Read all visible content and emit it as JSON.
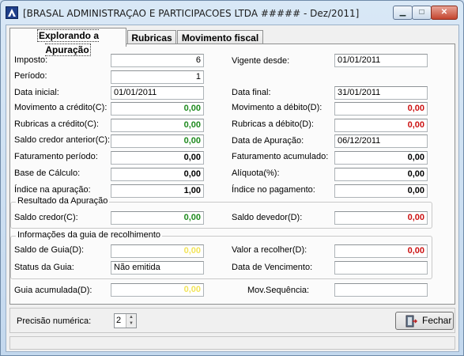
{
  "window": {
    "title": "[BRASAL ADMINISTRAÇAO E PARTICIPACOES LTDA ##### - Dez/2011]",
    "minimize": "▁",
    "maximize": "□",
    "close": "✕"
  },
  "tabs": [
    {
      "label": "Explorando a Apuração"
    },
    {
      "label": "Rubricas"
    },
    {
      "label": "Movimento fiscal"
    }
  ],
  "fields": {
    "imposto": {
      "label": "Imposto:",
      "value": "6"
    },
    "periodo": {
      "label": "Período:",
      "value": "1"
    },
    "data_inicial": {
      "label": "Data inicial:",
      "value": "01/01/2011"
    },
    "mov_credito": {
      "label": "Movimento a crédito(C):",
      "value": "0,00"
    },
    "rub_credito": {
      "label": "Rubricas a crédito(C):",
      "value": "0,00"
    },
    "saldo_credor_anterior": {
      "label": "Saldo credor anterior(C):",
      "value": "0,00"
    },
    "faturamento_periodo": {
      "label": "Faturamento período:",
      "value": "0,00"
    },
    "base_calculo": {
      "label": "Base de Cálculo:",
      "value": "0,00"
    },
    "indice_apuracao": {
      "label": "Índice na apuração:",
      "value": "1,00"
    },
    "vigente_desde": {
      "label": "Vigente desde:",
      "value": "01/01/2011"
    },
    "data_final": {
      "label": "Data final:",
      "value": "31/01/2011"
    },
    "mov_debito": {
      "label": "Movimento a débito(D):",
      "value": "0,00"
    },
    "rub_debito": {
      "label": "Rubricas a débito(D):",
      "value": "0,00"
    },
    "data_apuracao": {
      "label": "Data de Apuração:",
      "value": "06/12/2011"
    },
    "faturamento_acumulado": {
      "label": "Faturamento acumulado:",
      "value": "0,00"
    },
    "aliquota": {
      "label": "Alíquota(%):",
      "value": "0,00"
    },
    "indice_pagamento": {
      "label": "Índice no pagamento:",
      "value": "0,00"
    }
  },
  "resultado": {
    "title": "Resultado da Apuração",
    "saldo_credor": {
      "label": "Saldo credor(C):",
      "value": "0,00"
    },
    "saldo_devedor": {
      "label": "Saldo devedor(D):",
      "value": "0,00"
    }
  },
  "guia": {
    "title": "Informações da guia de recolhimento",
    "saldo_guia": {
      "label": "Saldo de Guia(D):",
      "value": "0,00"
    },
    "valor_recolher": {
      "label": "Valor a recolher(D):",
      "value": "0,00"
    },
    "status": {
      "label": "Status da Guia:",
      "value": "Não emitida"
    },
    "vencimento": {
      "label": "Data de Vencimento:",
      "value": ""
    }
  },
  "guia_acumulada": {
    "label": "Guia acumulada(D):",
    "value": "0,00"
  },
  "mov_sequencia": {
    "label": "Mov.Sequência:",
    "value": ""
  },
  "bottom": {
    "precisao_label": "Precisão numérica:",
    "precisao_value": "2",
    "fechar_label": "Fechar"
  },
  "colors": {
    "credit": "#1e8a1e",
    "debit": "#cc1111",
    "guide": "#f2e45a"
  }
}
